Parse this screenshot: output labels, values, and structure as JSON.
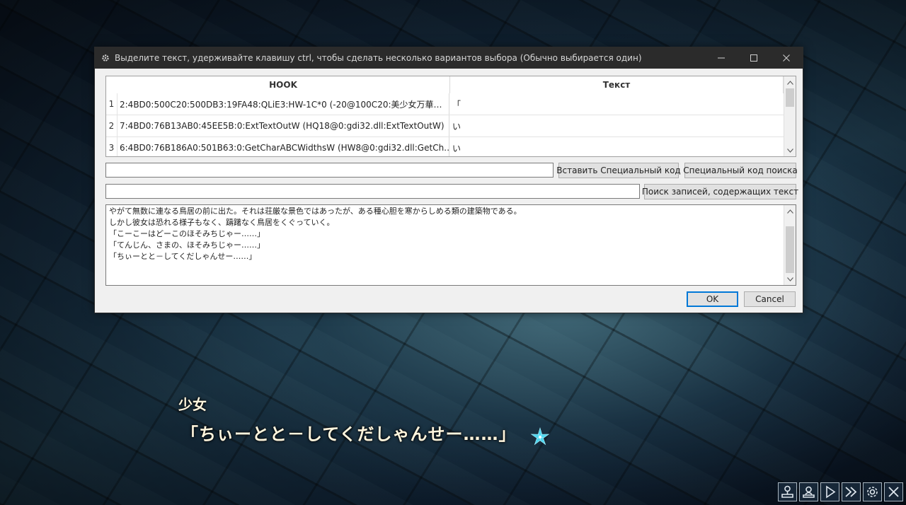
{
  "dialog": {
    "title": "Выделите текст, удерживайте клавишу ctrl, чтобы сделать несколько вариантов выбора (Обычно выбирается один)",
    "table": {
      "headers": [
        "HOOK",
        "Текст"
      ],
      "rows": [
        {
          "num": "1",
          "hook": "2:4BD0:500C20:500DB3:19FA48:QLiE3:HW-1C*0 (-20@100C20:美少女万華…",
          "text": "「"
        },
        {
          "num": "2",
          "hook": "7:4BD0:76B13AB0:45EE5B:0:ExtTextOutW (HQ18@0:gdi32.dll:ExtTextOutW)",
          "text": "い"
        },
        {
          "num": "3",
          "hook": "6:4BD0:76B186A0:501B63:0:GetCharABCWidthsW (HW8@0:gdi32.dll:GetCh…",
          "text": "い"
        }
      ]
    },
    "special_code_input": "",
    "insert_special_code_label": "Вставить Специальный код",
    "search_special_code_label": "Специальный код поиска",
    "search_text_input": "",
    "search_records_label": "Поиск записей, содержащих текст",
    "preview_lines": [
      "やがて無数に連なる鳥居の前に出た。それは荘厳な景色ではあったが、ある種心胆を寒からしめる類の建築物である。",
      "しかし彼女は恐れる様子もなく、躊躇なく鳥居をくぐっていく。",
      "「こーこーはどーこのほそみちじゃー……」",
      "「てんじん、さまの、ほそみちじゃー……」",
      "「ちぃーとと－してくだしゃんせー……」"
    ],
    "ok_label": "OK",
    "cancel_label": "Cancel"
  },
  "game": {
    "speaker": "少女",
    "dialogue": "「ちぃーとと－してくだしゃんせー……」",
    "buttons": [
      "save-icon",
      "load-icon",
      "play-icon",
      "fast-forward-icon",
      "settings-icon",
      "close-icon"
    ]
  }
}
